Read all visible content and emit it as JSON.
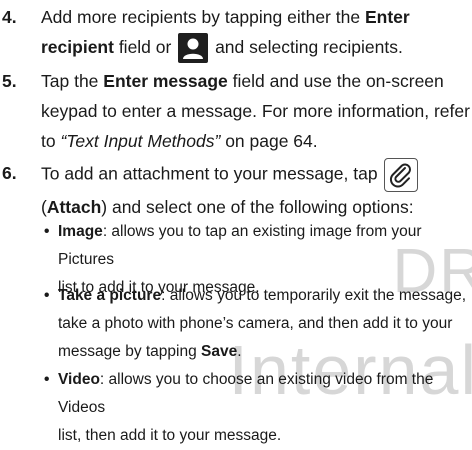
{
  "watermark": {
    "line1": "DR",
    "line2": "Internal"
  },
  "steps": [
    {
      "number": "4.",
      "parts": [
        "Add more recipients by tapping either the ",
        "Enter",
        "recipient",
        " field or ",
        " and selecting recipients."
      ]
    },
    {
      "number": "5.",
      "parts": [
        "Tap the ",
        "Enter message",
        " field and use the on-screen",
        "keypad to enter a message. For more information, refer",
        "to ",
        "“Text Input Methods”",
        " on page 64."
      ]
    },
    {
      "number": "6.",
      "parts": [
        "To add an attachment to your message, tap ",
        "(",
        "Attach",
        ") and select one of the following options:"
      ]
    }
  ],
  "options": [
    {
      "name": "Image",
      "lines": [
        ": allows you to tap an existing image from your Pictures",
        "list to add it to your message."
      ]
    },
    {
      "name": "Take a picture",
      "lines": [
        ": allows you to temporarily exit the message,",
        "take a photo with phone’s camera, and then add it to your",
        "message by tapping ",
        "Save",
        "."
      ]
    },
    {
      "name": "Video",
      "lines": [
        ": allows you to choose an existing video from the Videos",
        "list, then add it to your message."
      ]
    }
  ],
  "icons": {
    "recipient_icon": "person-icon",
    "attach_icon": "paperclip-icon"
  }
}
